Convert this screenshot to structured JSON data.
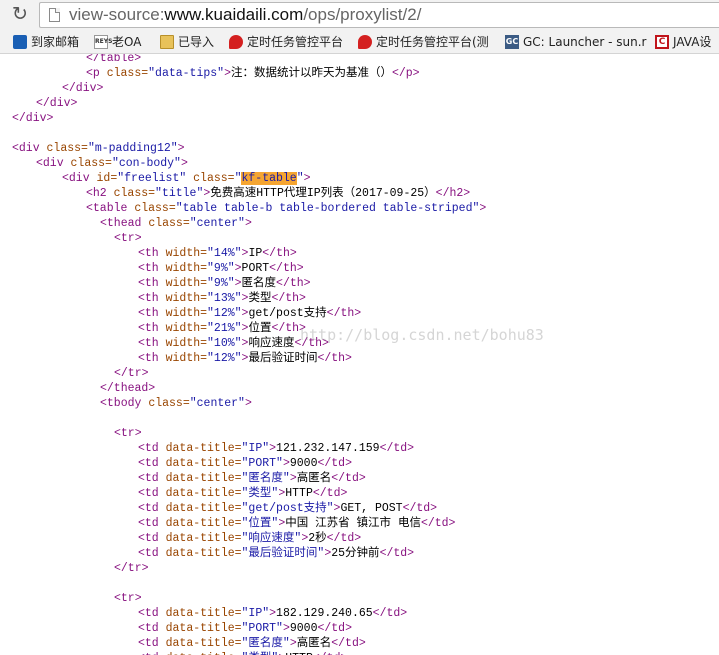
{
  "browser": {
    "url": {
      "scheme": "view-source:",
      "host": "www.kuaidaili.com",
      "path": "/ops/proxylist/2/"
    },
    "bookmarks": [
      {
        "label": "到家邮箱",
        "icon": "mail-icon"
      },
      {
        "label": "老OA",
        "icon": "reys-icon"
      },
      {
        "label": "已导入",
        "icon": "folder-icon"
      },
      {
        "label": "定时任务管控平台",
        "icon": "red-bird-icon"
      },
      {
        "label": "定时任务管控平台(测",
        "icon": "red-bird-icon"
      },
      {
        "label": "GC: Launcher - sun.r",
        "icon": "gc-icon"
      },
      {
        "label": "JAVA设",
        "icon": "java-icon"
      }
    ]
  },
  "source": {
    "lines": [
      [
        {
          "c": "t",
          "s": "</table>"
        }
      ],
      [
        {
          "c": "t",
          "s": "<p "
        },
        {
          "c": "a",
          "s": "class="
        },
        {
          "c": "v",
          "s": "\"data-tips\""
        },
        {
          "c": "t",
          "s": ">"
        },
        {
          "c": "",
          "s": "注：数据统计以昨天为基准（）"
        },
        {
          "c": "t",
          "s": "</p>"
        }
      ],
      [
        {
          "c": "t",
          "s": "</div>"
        }
      ],
      [
        {
          "c": "t",
          "s": "</div>"
        }
      ],
      [
        {
          "c": "t",
          "s": "</div>"
        }
      ],
      [],
      [
        {
          "c": "t",
          "s": "<div "
        },
        {
          "c": "a",
          "s": "class="
        },
        {
          "c": "v",
          "s": "\"m-padding12\""
        },
        {
          "c": "t",
          "s": ">"
        }
      ],
      [
        {
          "c": "t",
          "s": "<div "
        },
        {
          "c": "a",
          "s": "class="
        },
        {
          "c": "v",
          "s": "\"con-body\""
        },
        {
          "c": "t",
          "s": ">"
        }
      ],
      [
        {
          "c": "t",
          "s": "<div "
        },
        {
          "c": "a",
          "s": "id="
        },
        {
          "c": "v",
          "s": "\"freelist\""
        },
        {
          "c": "t",
          "s": " "
        },
        {
          "c": "a",
          "s": "class="
        },
        {
          "c": "v",
          "s": "\""
        },
        {
          "c": "v hl",
          "s": "kf-table"
        },
        {
          "c": "v",
          "s": "\""
        },
        {
          "c": "t",
          "s": ">"
        }
      ],
      [
        {
          "c": "t",
          "s": "<h2 "
        },
        {
          "c": "a",
          "s": "class="
        },
        {
          "c": "v",
          "s": "\"title\""
        },
        {
          "c": "t",
          "s": ">"
        },
        {
          "c": "",
          "s": "免费高速HTTP代理IP列表（2017-09-25）"
        },
        {
          "c": "t",
          "s": "</h2>"
        }
      ],
      [
        {
          "c": "t",
          "s": "<table "
        },
        {
          "c": "a",
          "s": "class="
        },
        {
          "c": "v",
          "s": "\"table table-b table-bordered table-striped\""
        },
        {
          "c": "t",
          "s": ">"
        }
      ],
      [
        {
          "c": "t",
          "s": "<thead "
        },
        {
          "c": "a",
          "s": "class="
        },
        {
          "c": "v",
          "s": "\"center\""
        },
        {
          "c": "t",
          "s": ">"
        }
      ],
      [
        {
          "c": "t",
          "s": "<tr>"
        }
      ],
      [
        {
          "c": "t",
          "s": "<th "
        },
        {
          "c": "a",
          "s": "width="
        },
        {
          "c": "v",
          "s": "\"14%\""
        },
        {
          "c": "t",
          "s": ">"
        },
        {
          "c": "",
          "s": "IP"
        },
        {
          "c": "t",
          "s": "</th>"
        }
      ],
      [
        {
          "c": "t",
          "s": "<th "
        },
        {
          "c": "a",
          "s": "width="
        },
        {
          "c": "v",
          "s": "\"9%\""
        },
        {
          "c": "t",
          "s": ">"
        },
        {
          "c": "",
          "s": "PORT"
        },
        {
          "c": "t",
          "s": "</th>"
        }
      ],
      [
        {
          "c": "t",
          "s": "<th "
        },
        {
          "c": "a",
          "s": "width="
        },
        {
          "c": "v",
          "s": "\"9%\""
        },
        {
          "c": "t",
          "s": ">"
        },
        {
          "c": "",
          "s": "匿名度"
        },
        {
          "c": "t",
          "s": "</th>"
        }
      ],
      [
        {
          "c": "t",
          "s": "<th "
        },
        {
          "c": "a",
          "s": "width="
        },
        {
          "c": "v",
          "s": "\"13%\""
        },
        {
          "c": "t",
          "s": ">"
        },
        {
          "c": "",
          "s": "类型"
        },
        {
          "c": "t",
          "s": "</th>"
        }
      ],
      [
        {
          "c": "t",
          "s": "<th "
        },
        {
          "c": "a",
          "s": "width="
        },
        {
          "c": "v",
          "s": "\"12%\""
        },
        {
          "c": "t",
          "s": ">"
        },
        {
          "c": "",
          "s": "get/post支持"
        },
        {
          "c": "t",
          "s": "</th>"
        }
      ],
      [
        {
          "c": "t",
          "s": "<th "
        },
        {
          "c": "a",
          "s": "width="
        },
        {
          "c": "v",
          "s": "\"21%\""
        },
        {
          "c": "t",
          "s": ">"
        },
        {
          "c": "",
          "s": "位置"
        },
        {
          "c": "t",
          "s": "</th>"
        }
      ],
      [
        {
          "c": "t",
          "s": "<th "
        },
        {
          "c": "a",
          "s": "width="
        },
        {
          "c": "v",
          "s": "\"10%\""
        },
        {
          "c": "t",
          "s": ">"
        },
        {
          "c": "",
          "s": "响应速度"
        },
        {
          "c": "t",
          "s": "</th>"
        }
      ],
      [
        {
          "c": "t",
          "s": "<th "
        },
        {
          "c": "a",
          "s": "width="
        },
        {
          "c": "v",
          "s": "\"12%\""
        },
        {
          "c": "t",
          "s": ">"
        },
        {
          "c": "",
          "s": "最后验证时间"
        },
        {
          "c": "t",
          "s": "</th>"
        }
      ],
      [
        {
          "c": "t",
          "s": "</tr>"
        }
      ],
      [
        {
          "c": "t",
          "s": "</thead>"
        }
      ],
      [
        {
          "c": "t",
          "s": "<tbody "
        },
        {
          "c": "a",
          "s": "class="
        },
        {
          "c": "v",
          "s": "\"center\""
        },
        {
          "c": "t",
          "s": ">"
        }
      ],
      [],
      [
        {
          "c": "t",
          "s": "<tr>"
        }
      ],
      [
        {
          "c": "t",
          "s": "<td "
        },
        {
          "c": "a",
          "s": "data-title="
        },
        {
          "c": "v",
          "s": "\"IP\""
        },
        {
          "c": "t",
          "s": ">"
        },
        {
          "c": "",
          "s": "121.232.147.159"
        },
        {
          "c": "t",
          "s": "</td>"
        }
      ],
      [
        {
          "c": "t",
          "s": "<td "
        },
        {
          "c": "a",
          "s": "data-title="
        },
        {
          "c": "v",
          "s": "\"PORT\""
        },
        {
          "c": "t",
          "s": ">"
        },
        {
          "c": "",
          "s": "9000"
        },
        {
          "c": "t",
          "s": "</td>"
        }
      ],
      [
        {
          "c": "t",
          "s": "<td "
        },
        {
          "c": "a",
          "s": "data-title="
        },
        {
          "c": "v",
          "s": "\"匿名度\""
        },
        {
          "c": "t",
          "s": ">"
        },
        {
          "c": "",
          "s": "高匿名"
        },
        {
          "c": "t",
          "s": "</td>"
        }
      ],
      [
        {
          "c": "t",
          "s": "<td "
        },
        {
          "c": "a",
          "s": "data-title="
        },
        {
          "c": "v",
          "s": "\"类型\""
        },
        {
          "c": "t",
          "s": ">"
        },
        {
          "c": "",
          "s": "HTTP"
        },
        {
          "c": "t",
          "s": "</td>"
        }
      ],
      [
        {
          "c": "t",
          "s": "<td "
        },
        {
          "c": "a",
          "s": "data-title="
        },
        {
          "c": "v",
          "s": "\"get/post支持\""
        },
        {
          "c": "t",
          "s": ">"
        },
        {
          "c": "",
          "s": "GET, POST"
        },
        {
          "c": "t",
          "s": "</td>"
        }
      ],
      [
        {
          "c": "t",
          "s": "<td "
        },
        {
          "c": "a",
          "s": "data-title="
        },
        {
          "c": "v",
          "s": "\"位置\""
        },
        {
          "c": "t",
          "s": ">"
        },
        {
          "c": "",
          "s": "中国 江苏省 镇江市 电信"
        },
        {
          "c": "t",
          "s": "</td>"
        }
      ],
      [
        {
          "c": "t",
          "s": "<td "
        },
        {
          "c": "a",
          "s": "data-title="
        },
        {
          "c": "v",
          "s": "\"响应速度\""
        },
        {
          "c": "t",
          "s": ">"
        },
        {
          "c": "",
          "s": "2秒"
        },
        {
          "c": "t",
          "s": "</td>"
        }
      ],
      [
        {
          "c": "t",
          "s": "<td "
        },
        {
          "c": "a",
          "s": "data-title="
        },
        {
          "c": "v",
          "s": "\"最后验证时间\""
        },
        {
          "c": "t",
          "s": ">"
        },
        {
          "c": "",
          "s": "25分钟前"
        },
        {
          "c": "t",
          "s": "</td>"
        }
      ],
      [
        {
          "c": "t",
          "s": "</tr>"
        }
      ],
      [],
      [
        {
          "c": "t",
          "s": "<tr>"
        }
      ],
      [
        {
          "c": "t",
          "s": "<td "
        },
        {
          "c": "a",
          "s": "data-title="
        },
        {
          "c": "v",
          "s": "\"IP\""
        },
        {
          "c": "t",
          "s": ">"
        },
        {
          "c": "",
          "s": "182.129.240.65"
        },
        {
          "c": "t",
          "s": "</td>"
        }
      ],
      [
        {
          "c": "t",
          "s": "<td "
        },
        {
          "c": "a",
          "s": "data-title="
        },
        {
          "c": "v",
          "s": "\"PORT\""
        },
        {
          "c": "t",
          "s": ">"
        },
        {
          "c": "",
          "s": "9000"
        },
        {
          "c": "t",
          "s": "</td>"
        }
      ],
      [
        {
          "c": "t",
          "s": "<td "
        },
        {
          "c": "a",
          "s": "data-title="
        },
        {
          "c": "v",
          "s": "\"匿名度\""
        },
        {
          "c": "t",
          "s": ">"
        },
        {
          "c": "",
          "s": "高匿名"
        },
        {
          "c": "t",
          "s": "</td>"
        }
      ],
      [
        {
          "c": "t",
          "s": "<td "
        },
        {
          "c": "a",
          "s": "data-title="
        },
        {
          "c": "v",
          "s": "\"类型\""
        },
        {
          "c": "t",
          "s": ">"
        },
        {
          "c": "",
          "s": "HTTP"
        },
        {
          "c": "t",
          "s": "</td>"
        }
      ]
    ]
  },
  "watermark": "http://blog.csdn.net/bohu83"
}
